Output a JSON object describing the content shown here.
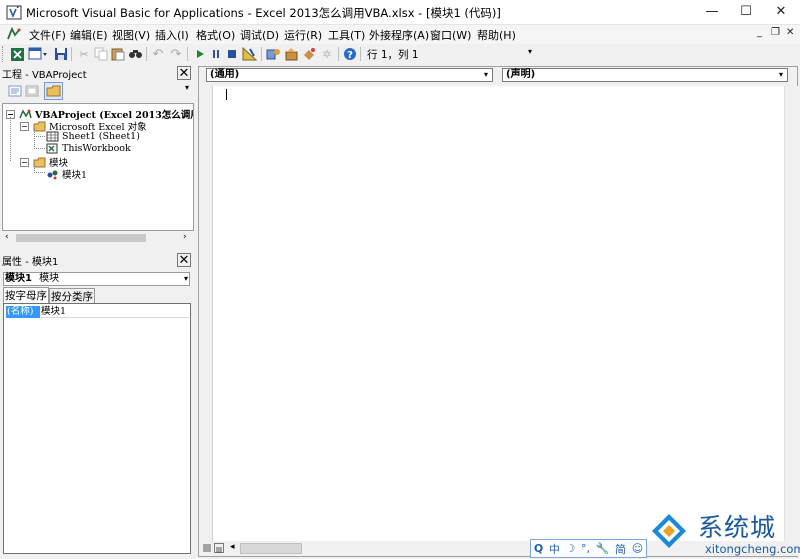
{
  "window": {
    "title": "Microsoft Visual Basic for Applications - Excel 2013怎么调用VBA.xlsx - [模块1 (代码)]",
    "minimize": "—",
    "maximize": "☐",
    "close": "✕"
  },
  "menu": {
    "items": [
      "文件(F)",
      "编辑(E)",
      "视图(V)",
      "插入(I)",
      "格式(O)",
      "调试(D)",
      "运行(R)",
      "工具(T)",
      "外接程序(A)",
      "窗口(W)",
      "帮助(H)"
    ],
    "mdi_minimize": "_",
    "mdi_restore": "❐",
    "mdi_close": "✕"
  },
  "toolbar": {
    "icons": [
      "excel-icon",
      "insert-userform-icon",
      "save-icon",
      "cut-icon",
      "copy-icon",
      "paste-icon",
      "find-icon",
      "undo-icon",
      "redo-icon",
      "run-icon",
      "break-icon",
      "reset-icon",
      "design-mode-icon",
      "project-explorer-icon",
      "properties-icon",
      "object-browser-icon",
      "toolbox-icon",
      "help-icon"
    ],
    "position": "行 1，列 1"
  },
  "project_panel": {
    "title": "工程 - VBAProject",
    "close": "✕",
    "tree": [
      {
        "label": "VBAProject (Excel 2013怎么调用",
        "bold": true
      },
      {
        "label": "Microsoft Excel 对象",
        "bold": false
      },
      {
        "label": "Sheet1 (Sheet1)",
        "bold": false
      },
      {
        "label": "ThisWorkbook",
        "bold": false
      },
      {
        "label": "模块",
        "bold": false
      },
      {
        "label": "模块1",
        "bold": false
      }
    ],
    "expanders": [
      "−",
      "−",
      "−"
    ]
  },
  "properties_panel": {
    "title": "属性 - 模块1",
    "close": "✕",
    "object_name": "模块1",
    "object_type": "模块",
    "tabs": [
      "按字母序",
      "按分类序"
    ],
    "rows": [
      {
        "name": "(名称)",
        "value": "模块1"
      }
    ]
  },
  "code_window": {
    "object_combo": "(通用)",
    "procedure_combo": "(声明)",
    "content": ""
  },
  "ime": {
    "items": [
      "中",
      "☽",
      "°,",
      "🔧",
      "简",
      "☺"
    ],
    "search": "Q"
  },
  "watermark": {
    "name": "系统城",
    "url": "xitongcheng.com"
  },
  "colors": {
    "selection": "#3399ff",
    "panel_header": "#ccd5e6",
    "background": "#f0f0f0",
    "ime_blue": "#2060b0"
  }
}
